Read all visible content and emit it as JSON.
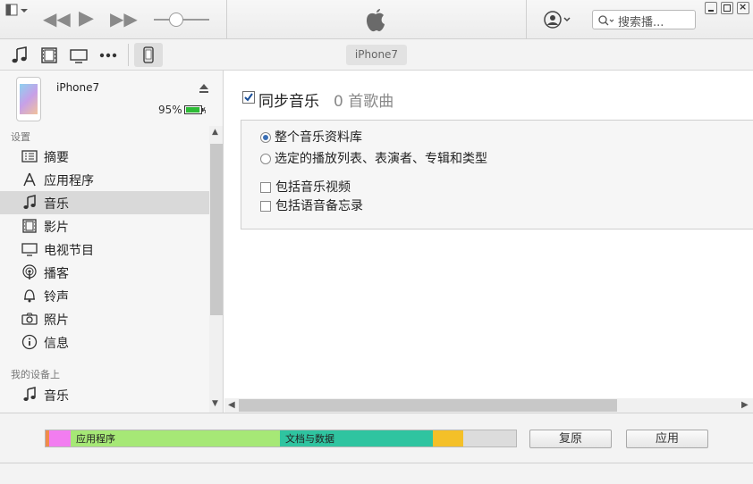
{
  "titlebar": {
    "search_placeholder": "搜索播..."
  },
  "navbar": {
    "device_tab": "iPhone7"
  },
  "device": {
    "name": "iPhone7",
    "battery_percent": "95%",
    "battery_level": 0.95
  },
  "sidebar": {
    "section_settings": "设置",
    "settings_items": [
      {
        "label": "摘要",
        "icon": "summary-icon"
      },
      {
        "label": "应用程序",
        "icon": "apps-icon"
      },
      {
        "label": "音乐",
        "icon": "music-note-icon",
        "active": true
      },
      {
        "label": "影片",
        "icon": "film-icon"
      },
      {
        "label": "电视节目",
        "icon": "tv-icon"
      },
      {
        "label": "播客",
        "icon": "podcast-icon"
      },
      {
        "label": "铃声",
        "icon": "bell-icon"
      },
      {
        "label": "照片",
        "icon": "camera-icon"
      },
      {
        "label": "信息",
        "icon": "info-icon"
      }
    ],
    "section_on_device": "我的设备上",
    "device_items": [
      {
        "label": "音乐",
        "icon": "music-note-icon"
      }
    ]
  },
  "main": {
    "sync_label": "同步音乐",
    "sync_count": "0 首歌曲",
    "sync_checked": true,
    "options": {
      "entire_library": "整个音乐资料库",
      "selected": "选定的播放列表、表演者、专辑和类型",
      "include_videos": "包括音乐视频",
      "include_memos": "包括语音备忘录"
    }
  },
  "footer": {
    "apps_label": "应用程序",
    "docs_label": "文档与数据",
    "revert_button": "复原",
    "apply_button": "应用"
  },
  "colors": {
    "apps": "#a6e876",
    "docs": "#2fc4a0",
    "photos": "#f27df0",
    "other": "#f4c028",
    "audio": "#f08b4a",
    "free": "#dcdcdc"
  }
}
